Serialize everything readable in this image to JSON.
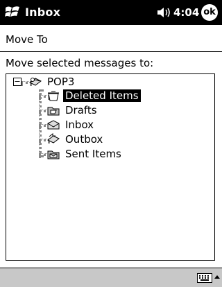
{
  "titlebar": {
    "app_title": "Inbox",
    "clock": "4:04",
    "ok_label": "ok"
  },
  "subtitle": "Move To",
  "prompt": "Move selected messages to:",
  "tree": {
    "root": {
      "label": "POP3",
      "expanded": true,
      "icon": "mailbox-icon"
    },
    "children": [
      {
        "label": "Deleted Items",
        "icon": "deleted-folder-icon",
        "selected": true
      },
      {
        "label": "Drafts",
        "icon": "drafts-folder-icon",
        "selected": false
      },
      {
        "label": "Inbox",
        "icon": "inbox-folder-icon",
        "selected": false
      },
      {
        "label": "Outbox",
        "icon": "outbox-folder-icon",
        "selected": false
      },
      {
        "label": "Sent Items",
        "icon": "sent-folder-icon",
        "selected": false
      }
    ]
  },
  "colors": {
    "titlebar_bg": "#000000",
    "menubar_bg": "#c8c8c8",
    "selection_bg": "#000000"
  }
}
